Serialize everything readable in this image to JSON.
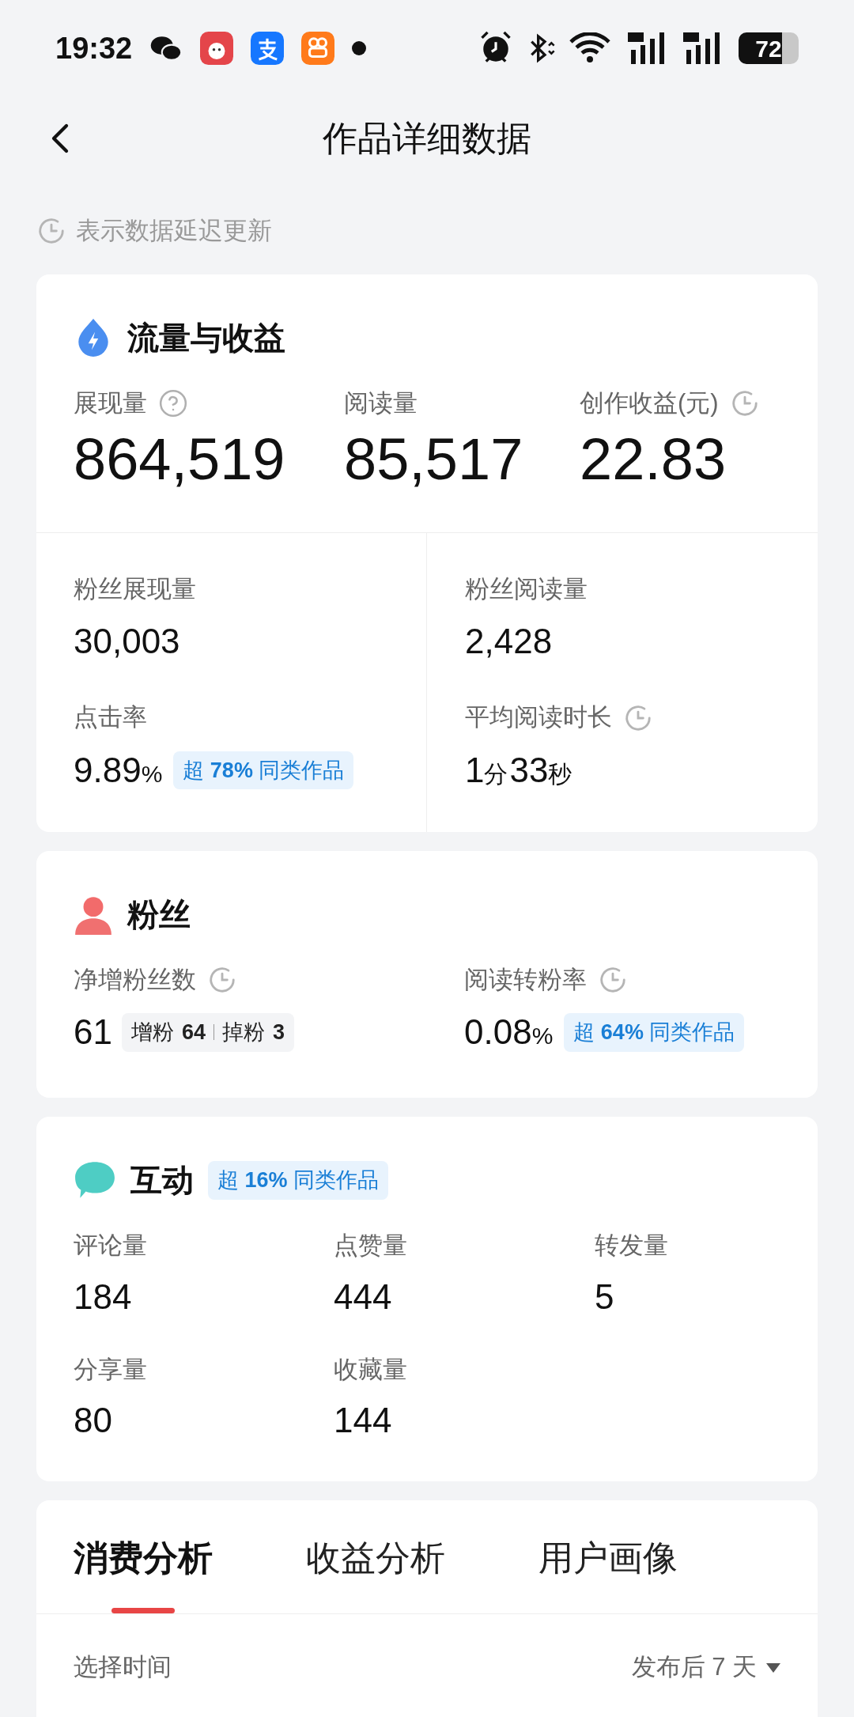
{
  "status_bar": {
    "time": "19:32",
    "battery": "72"
  },
  "header": {
    "title": "作品详细数据"
  },
  "notice": "表示数据延迟更新",
  "traffic": {
    "title": "流量与收益",
    "main_metrics": [
      {
        "label": "展现量",
        "help_icon": true,
        "value": "864,519"
      },
      {
        "label": "阅读量",
        "value": "85,517"
      },
      {
        "label": "创作收益(元)",
        "delayed_icon": true,
        "value": "22.83"
      }
    ],
    "sub_metrics": [
      {
        "label": "粉丝展现量",
        "value": [
          {
            "kind": "number",
            "text": "30,003"
          }
        ]
      },
      {
        "label": "粉丝阅读量",
        "value": [
          {
            "kind": "number",
            "text": "2,428"
          }
        ]
      },
      {
        "label": "点击率",
        "value": [
          {
            "kind": "number",
            "text": "9.89"
          },
          {
            "kind": "unit",
            "text": "%"
          }
        ],
        "badge": "超 **78%** 同类作品"
      },
      {
        "label": "平均阅读时长",
        "delayed_icon": true,
        "value": [
          {
            "kind": "number",
            "text": "1"
          },
          {
            "kind": "unit",
            "text": "分"
          },
          {
            "kind": "number",
            "text": "33"
          },
          {
            "kind": "unit",
            "text": "秒"
          }
        ]
      }
    ]
  },
  "fans": {
    "title": "粉丝",
    "metrics": [
      {
        "label": "净增粉丝数",
        "delayed_icon": true,
        "value": [
          {
            "kind": "number",
            "text": "61"
          }
        ],
        "breakdown": [
          {
            "label": "增粉",
            "value": "64"
          },
          {
            "label": "掉粉",
            "value": "3"
          }
        ]
      },
      {
        "label": "阅读转粉率",
        "delayed_icon": true,
        "value": [
          {
            "kind": "number",
            "text": "0.08"
          },
          {
            "kind": "unit",
            "text": "%"
          }
        ],
        "badge": "超 **64%** 同类作品"
      }
    ]
  },
  "interaction": {
    "title": "互动",
    "badge": "超 **16%** 同类作品",
    "metrics": [
      {
        "label": "评论量",
        "value": "184"
      },
      {
        "label": "点赞量",
        "value": "444"
      },
      {
        "label": "转发量",
        "value": "5"
      },
      {
        "label": "分享量",
        "value": "80"
      },
      {
        "label": "收藏量",
        "value": "144"
      }
    ]
  },
  "analysis": {
    "tabs": [
      {
        "label": "消费分析",
        "selected": true
      },
      {
        "label": "收益分析",
        "selected": false
      },
      {
        "label": "用户画像",
        "selected": false
      }
    ],
    "time_filter": {
      "label": "选择时间",
      "value": "发布后 7 天"
    }
  }
}
